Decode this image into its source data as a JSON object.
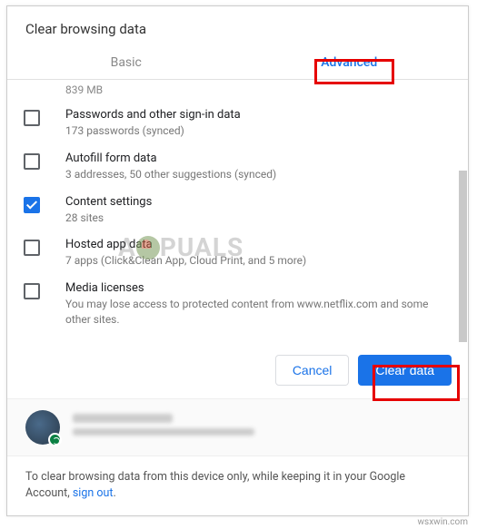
{
  "title": "Clear browsing data",
  "tabs": {
    "basic": "Basic",
    "advanced": "Advanced"
  },
  "truncated": "839 MB",
  "items": [
    {
      "label": "Passwords and other sign-in data",
      "sub": "173 passwords (synced)",
      "checked": false
    },
    {
      "label": "Autofill form data",
      "sub": "3 addresses, 50 other suggestions (synced)",
      "checked": false
    },
    {
      "label": "Content settings",
      "sub": "28 sites",
      "checked": true
    },
    {
      "label": "Hosted app data",
      "sub": "7 apps (Click&Clean App, Cloud Print, and 5 more)",
      "checked": false
    },
    {
      "label": "Media licenses",
      "sub": "You may lose access to protected content from www.netflix.com and some other sites.",
      "checked": false
    }
  ],
  "buttons": {
    "cancel": "Cancel",
    "clear": "Clear data"
  },
  "footer": {
    "text": "To clear browsing data from this device only, while keeping it in your Google Account, ",
    "link": "sign out",
    "period": "."
  },
  "watermark": {
    "left": "A",
    "right": "PUALS"
  },
  "source": "wsxwin.com"
}
